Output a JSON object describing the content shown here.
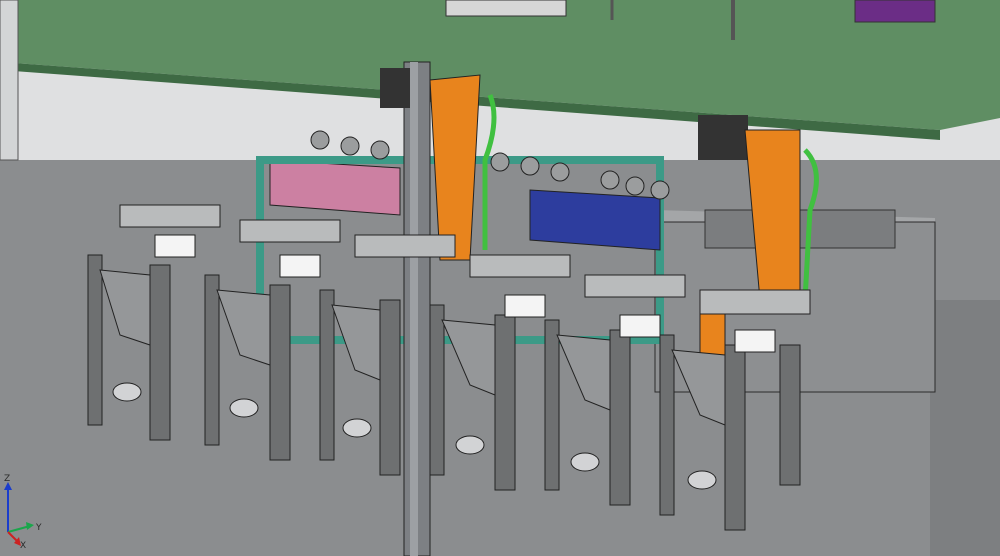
{
  "viewport": {
    "background_colors": {
      "ceiling_plate": "#5e8d62",
      "floor": "#87898b",
      "wall": "#c9cbcd",
      "robot_orange": "#e8841d",
      "cable_green": "#40c040",
      "tray_pink": "#cc7fa0",
      "frame_teal": "#3c9a87",
      "plate_blue": "#2c3c9c",
      "bin_grey": "#8c8d8e",
      "stand_grey": "#6d6f70",
      "cabinet_purple": "#6b2d86"
    }
  },
  "triad": {
    "z_label": "Z",
    "x_label": "X",
    "y_label": "Y",
    "colors": {
      "z": "#1a3ccc",
      "x": "#cc2222",
      "y": "#1aa64b"
    }
  }
}
